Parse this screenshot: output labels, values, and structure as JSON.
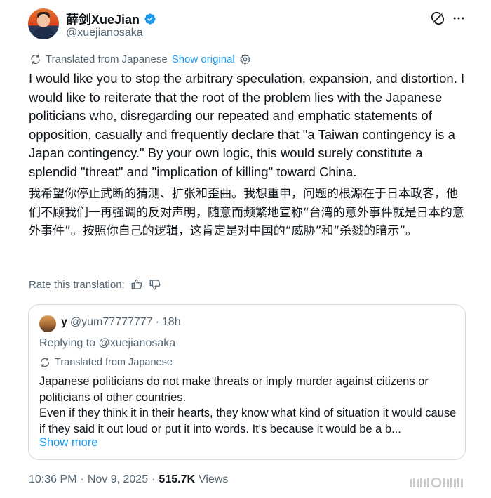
{
  "author": {
    "display_name": "薛剑XueJian",
    "handle": "@xuejianosaka"
  },
  "translation": {
    "label": "Translated from Japanese",
    "show_original": "Show original"
  },
  "post": {
    "english_text": "I would like you to stop the arbitrary speculation, expansion, and distortion. I would like to reiterate that the root of the problem lies with the Japanese politicians who, disregarding our repeated and emphatic statements of opposition, casually and frequently declare that \"a Taiwan contingency is a Japan contingency.\" By your own logic, this would surely constitute a splendid \"threat\" and \"implication of killing\" toward China.",
    "chinese_text": "我希望你停止武断的猜测、扩张和歪曲。我想重申，问题的根源在于日本政客，他们不顾我们一再强调的反对声明，随意而频繁地宣称“台湾的意外事件就是日本的意外事件”。按照你自己的逻辑，这肯定是对中国的“威胁”和“杀戮的暗示”。"
  },
  "rate": {
    "label": "Rate this translation:"
  },
  "quote": {
    "name": "y",
    "handle": "@yum77777777",
    "separator": "·",
    "time": "18h",
    "replying_to": "Replying to @xuejianosaka",
    "translated_label": "Translated from Japanese",
    "text": "Japanese politicians do not make threats or imply murder against citizens or politicians of other countries.\nEven if they think it in their hearts, they know what kind of situation it would cause if they said it out loud or put it into words.    It's because it would be a b...",
    "show_more": "Show more"
  },
  "footer": {
    "time": "10:36 PM",
    "separator": "·",
    "date": "Nov 9, 2025",
    "separator2": "·",
    "views_count": "515.7K",
    "views_label": "Views"
  },
  "colors": {
    "link": "#1d9bf0",
    "muted": "#536471",
    "text": "#0f1419",
    "border": "#cfd9de"
  }
}
